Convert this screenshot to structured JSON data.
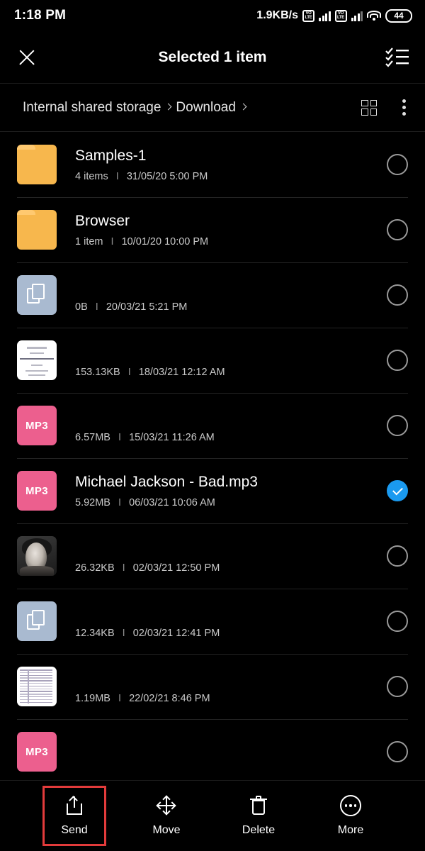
{
  "status_bar": {
    "time": "1:18 PM",
    "network_speed": "1.9KB/s",
    "volte_label_top": "VO",
    "volte_label_bottom": "LTE",
    "battery_level": "44"
  },
  "selection_header": {
    "close_label": "close-icon",
    "title": "Selected 1 item",
    "select_all_label": "select-all-icon"
  },
  "breadcrumb": {
    "items": [
      "Internal shared storage",
      "Download"
    ],
    "grid_view_label": "grid-view-icon",
    "overflow_label": "more-options-icon"
  },
  "files": [
    {
      "name": "Samples-1",
      "redacted": false,
      "size": "4 items",
      "date": "31/05/20 5:00 PM",
      "icon": "folder-icon",
      "selected": false
    },
    {
      "name": "Browser",
      "redacted": false,
      "size": "1 item",
      "date": "10/01/20 10:00 PM",
      "icon": "folder-icon",
      "selected": false
    },
    {
      "name": "redacted file name",
      "redacted": true,
      "size": "0B",
      "date": "20/03/21 5:21 PM",
      "icon": "document-icon",
      "selected": false
    },
    {
      "name": "redacted file name",
      "redacted": true,
      "size": "153.13KB",
      "date": "18/03/21 12:12 AM",
      "icon": "certificate-thumbnail",
      "selected": false
    },
    {
      "name": "redacted file name",
      "redacted": true,
      "size": "6.57MB",
      "date": "15/03/21 11:26 AM",
      "icon": "mp3-icon",
      "selected": false
    },
    {
      "name": "Michael Jackson - Bad.mp3",
      "redacted": false,
      "size": "5.92MB",
      "date": "06/03/21 10:06 AM",
      "icon": "mp3-icon",
      "selected": true
    },
    {
      "name": "redacted file name",
      "redacted": true,
      "size": "26.32KB",
      "date": "02/03/21 12:50 PM",
      "icon": "photo-thumbnail",
      "selected": false
    },
    {
      "name": "redacted file name",
      "redacted": true,
      "size": "12.34KB",
      "date": "02/03/21 12:41 PM",
      "icon": "document-icon",
      "selected": false
    },
    {
      "name": "redacted file name",
      "redacted": true,
      "size": "1.19MB",
      "date": "22/02/21 8:46 PM",
      "icon": "spreadsheet-thumbnail",
      "selected": false
    },
    {
      "name": "redacted file name",
      "redacted": true,
      "size": "",
      "date": "",
      "icon": "mp3-icon",
      "selected": false
    }
  ],
  "file_meta_separator": "I",
  "mp3_badge": "MP3",
  "action_bar": {
    "send": "Send",
    "move": "Move",
    "delete": "Delete",
    "more": "More"
  },
  "colors": {
    "background": "#000000",
    "accent_selected": "#1a9af0",
    "folder": "#f7b74d",
    "mp3": "#ec5f8e",
    "document": "#a9bad0",
    "highlight_box": "#e23b3b"
  }
}
